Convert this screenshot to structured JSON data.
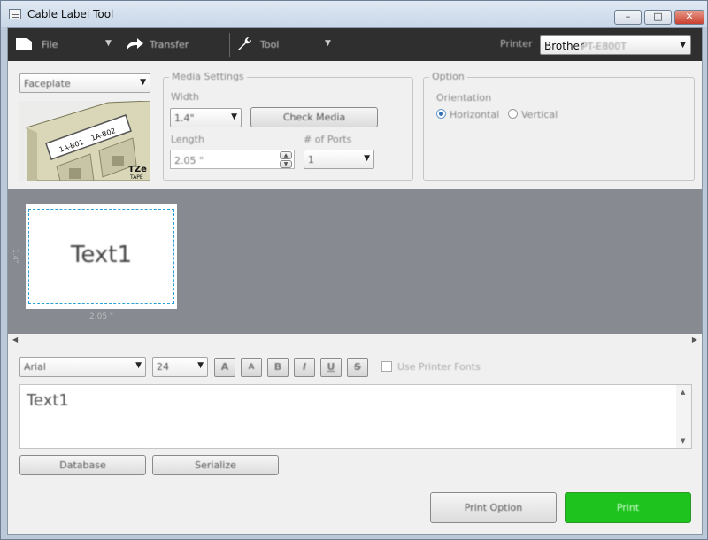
{
  "window": {
    "title": "Cable Label Tool"
  },
  "window_controls": {
    "minimize": "–",
    "maximize": "□",
    "close": "✕"
  },
  "toolbar": {
    "file": "File",
    "transfer": "Transfer",
    "tool": "Tool",
    "printer_label": "Printer",
    "printer_value": "Brother",
    "printer_model": "PT-E800T"
  },
  "template": {
    "selected": "Faceplate"
  },
  "preview": {
    "text1": "1A-B01",
    "text2": "1A-B02",
    "brand": "TZe",
    "tape": "TAPE"
  },
  "media_settings": {
    "title": "Media Settings",
    "width_label": "Width",
    "width_value": "1.4\"",
    "check_media": "Check Media",
    "length_label": "Length",
    "length_value": "2.05 \"",
    "ports_label": "# of Ports",
    "ports_value": "1"
  },
  "option": {
    "title": "Option",
    "orientation_label": "Orientation",
    "horizontal": "Horizontal",
    "vertical": "Vertical",
    "selected": "horizontal"
  },
  "canvas": {
    "label_text": "Text1",
    "width_ruler": "2.05 \"",
    "height_ruler": "1.4\""
  },
  "format": {
    "font": "Arial",
    "size": "24",
    "bigger": "A",
    "smaller": "A",
    "bold": "B",
    "italic": "I",
    "underline": "U",
    "strike": "S",
    "use_printer_fonts": "Use Printer Fonts"
  },
  "editor": {
    "text": "Text1"
  },
  "bottom": {
    "database": "Database",
    "serialize": "Serialize",
    "print_option": "Print Option",
    "print": "Print"
  },
  "colors": {
    "print_green": "#1ec31e",
    "toolbar": "#2f2f2f",
    "canvas_bg": "#878a91",
    "selection_border": "#2aa0d6"
  }
}
